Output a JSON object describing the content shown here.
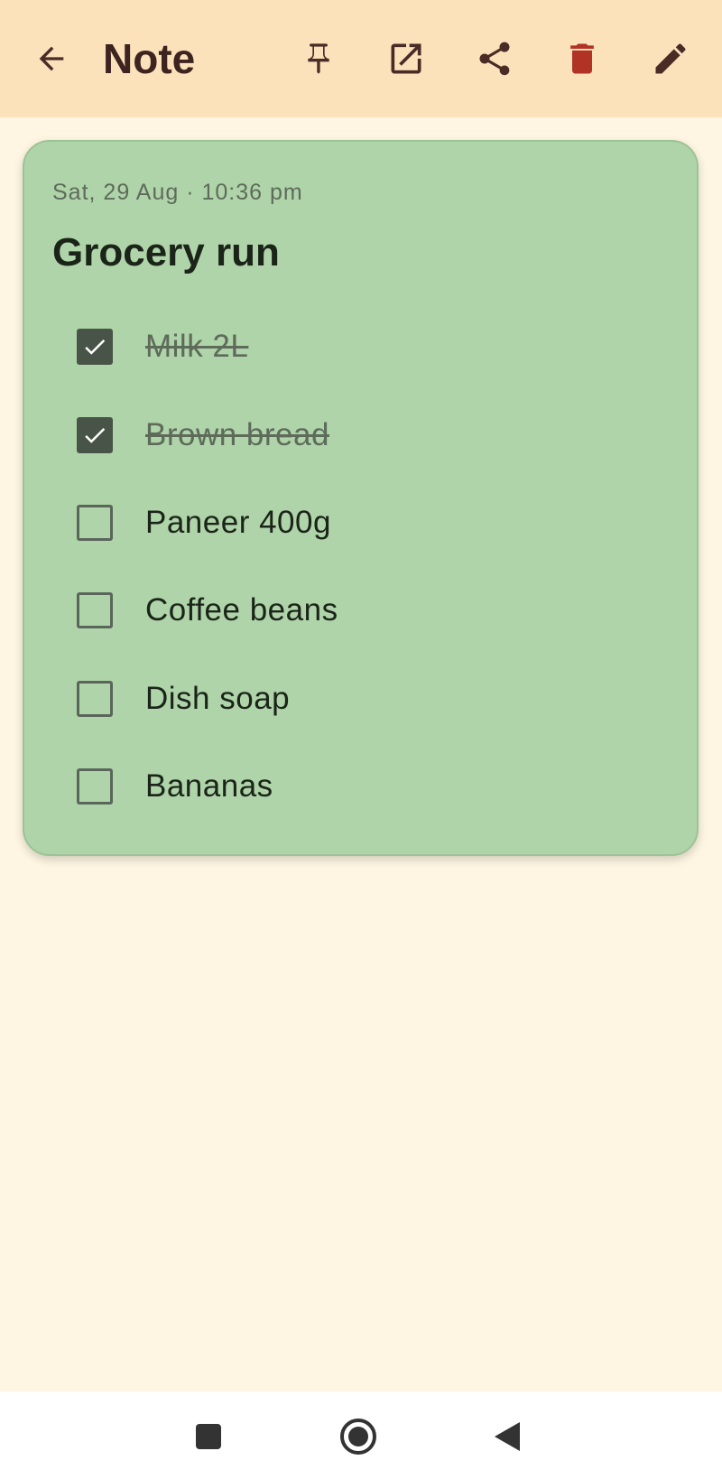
{
  "app_bar": {
    "title": "Note",
    "icons": [
      "back-arrow-icon",
      "pin-icon",
      "open-external-icon",
      "share-icon",
      "delete-icon",
      "edit-pencil-icon"
    ],
    "colors": {
      "background": "#FBE2BB",
      "icon": "#4A2C27",
      "delete": "#B03326"
    }
  },
  "note": {
    "date": "Sat, 29 Aug · 10:36 pm",
    "title": "Grocery run",
    "color": "#AFD4A9",
    "items": [
      {
        "label": "Milk 2L",
        "checked": true
      },
      {
        "label": "Brown bread",
        "checked": true
      },
      {
        "label": "Paneer 400g",
        "checked": false
      },
      {
        "label": "Coffee beans",
        "checked": false
      },
      {
        "label": "Dish soap",
        "checked": false
      },
      {
        "label": "Bananas",
        "checked": false
      }
    ]
  },
  "nav": {
    "icons": [
      "recents-square-icon",
      "home-circle-icon",
      "back-triangle-icon"
    ]
  }
}
